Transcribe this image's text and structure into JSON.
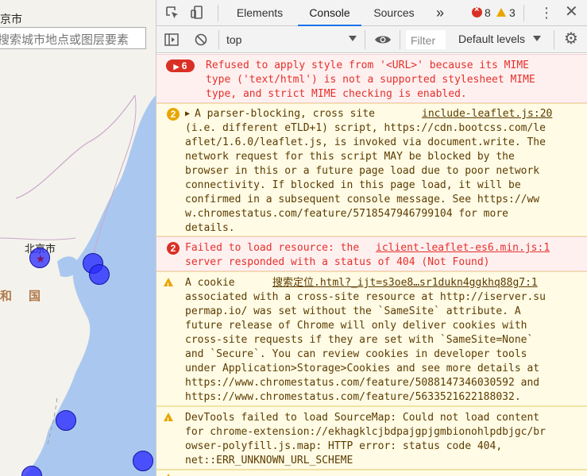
{
  "map": {
    "title": "京市",
    "search_placeholder": "搜索城市地点或图层要素",
    "city_label": "北京市",
    "country_chars": [
      "和",
      "国"
    ],
    "land_color": "#f4f2ed",
    "water_color": "#aac8ef",
    "marker_color": "#2828ff"
  },
  "devtools": {
    "tabs": [
      "Elements",
      "Console",
      "Sources"
    ],
    "active_tab": "Console",
    "more_tabs": "»",
    "error_count": "8",
    "warning_count": "3",
    "context": "top",
    "filter_placeholder": "Filter",
    "levels": "Default levels",
    "accent_color": "#1a73e8"
  },
  "messages": [
    {
      "type": "error",
      "count": "6",
      "lines": [
        "Refused to apply style from '<URL>' because its MIME",
        "type ('text/html') is not a supported stylesheet MIME",
        "type, and strict MIME checking is enabled."
      ]
    },
    {
      "type": "warning",
      "count": "2",
      "source": "include-leaflet.js:20",
      "lines": [
        "A parser-blocking, cross site",
        "(i.e. different eTLD+1) script, https://cdn.bootcss.com/le",
        "aflet/1.6.0/leaflet.js, is invoked via document.write. The",
        "network request for this script MAY be blocked by the",
        "browser in this or a future page load due to poor network",
        "connectivity. If blocked in this page load, it will be",
        "confirmed in a subsequent console message. See https://ww",
        "w.chromestatus.com/feature/5718547946799104 for more",
        "details."
      ]
    },
    {
      "type": "error",
      "count": "2",
      "source": "iclient-leaflet-es6.min.js:1",
      "lines": [
        "Failed to load resource: the",
        "server responded with a status of 404 (Not Found)"
      ]
    },
    {
      "type": "warning",
      "source": "搜索定位.html?_ijt=s3oe8…sr1dukn4ggkhq88g7:1",
      "lines": [
        "A cookie",
        "associated with a cross-site resource at http://iserver.su",
        "permap.io/ was set without the `SameSite` attribute. A",
        "future release of Chrome will only deliver cookies with",
        "cross-site requests if they are set with `SameSite=None`",
        "and `Secure`. You can review cookies in developer tools",
        "under Application>Storage>Cookies and see more details at",
        "https://www.chromestatus.com/feature/5088147346030592 and",
        "https://www.chromestatus.com/feature/5633521622188032."
      ]
    },
    {
      "type": "warning",
      "lines": [
        "DevTools failed to load SourceMap: Could not load content",
        "for chrome-extension://ekhagklcjbdpajgpjgmbionohlpdbjgc/br",
        "owser-polyfill.js.map: HTTP error: status code 404,",
        "net::ERR_UNKNOWN_URL_SCHEME"
      ]
    }
  ]
}
